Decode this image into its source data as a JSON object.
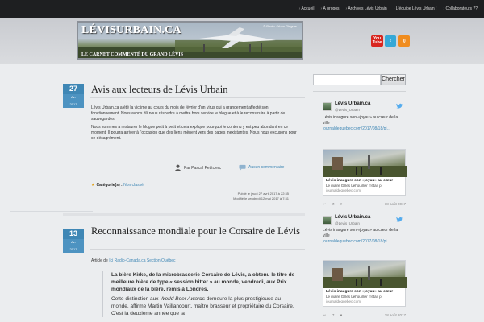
{
  "nav": {
    "items": [
      "Accueil",
      "À propos",
      "Archives Lévis Urbain",
      "L'équipe Lévis Urbain !",
      "Collaborateurs ??"
    ]
  },
  "header": {
    "site_title": "LÉVISURBAIN.CA",
    "tagline": "LE CARNET COMMENTÉ DU GRAND LÉVIS",
    "photo_credit": "© Photo : Yvan Gingras"
  },
  "social": {
    "youtube_top": "You",
    "youtube_bottom": "Tube",
    "twitter": "t",
    "rss": "))"
  },
  "posts": [
    {
      "day": "27",
      "month": "Avr",
      "year": "2017",
      "title": "Avis aux lecteurs de Lévis Urbain",
      "para1": "Lévis Urbain.ca a été la victime au cours du mois de février d'un virus qui a grandement affecté son fonctionnement. Nous avons dû nous résoudre à mettre hors service le blogue et à le reconstruire à partir de sauvegardes.",
      "para2": "Nous sommes à restaurer le blogue petit à petit et cela explique pourquoi le contenu y est peu abondant en ce moment. Il pourra arriver à l'occasion que des liens mènent vers des pages inexistantes. Nous nous excusons pour ce désagrément.",
      "author": "Par Pascal Petitclerc",
      "comments": "Aucun commentaire",
      "category_label": "Catégorie(s) :",
      "category": "Non classé",
      "published": "Publié le jeudi 27 avril 2017 à 22:35",
      "modified": "Modifié le vendredi 12 mai 2017 à 7:31"
    },
    {
      "day": "13",
      "month": "Avr",
      "year": "2017",
      "title": "Reconnaissance mondiale pour le Corsaire de Lévis",
      "source_prefix": "Article de",
      "source_link": "Ici Radio-Canada.ca Section Québec",
      "quote_lead": "La bière Kirke, de la microbrasserie Corsaire de Lévis, a obtenu le titre de meilleure bière de type « session bitter » au monde, vendredi, aux Prix mondiaux de la bière, remis à Londres.",
      "quote_a": "Cette distinction aux",
      "quote_em": "World Beer Awards",
      "quote_b": "demeure la plus prestigieuse au monde, affirme Martin Vaillancourt, maître brasseur et propriétaire du Corsaire. C'est la deuxième année que la"
    }
  ],
  "sidebar": {
    "search_placeholder": "",
    "search_button": "Chercher",
    "tweets": [
      {
        "name": "Lévis Urbain.ca",
        "handle": "@Levis_Urbain",
        "text": "Lévis inaugure son «joyau» au cœur de la ville",
        "link": "journaldequebec.com/2017/08/18/pi…",
        "card_title": "Lévis inaugure son «joyau» au cœur",
        "card_desc": "Le maire Gilles Lehouillier n'était p",
        "card_domain": "journaldequebec.com",
        "date": "18 août 2017"
      },
      {
        "name": "Lévis Urbain.ca",
        "handle": "@Levis_Urbain",
        "text": "Lévis inaugure son «joyau» au cœur de la ville",
        "link": "journaldequebec.com/2017/08/18/pi…",
        "card_title": "Lévis inaugure son «joyau» au cœur",
        "card_desc": "Le maire Gilles Lehouillier n'était p",
        "card_domain": "journaldequebec.com",
        "date": "18 août 2017"
      }
    ]
  }
}
